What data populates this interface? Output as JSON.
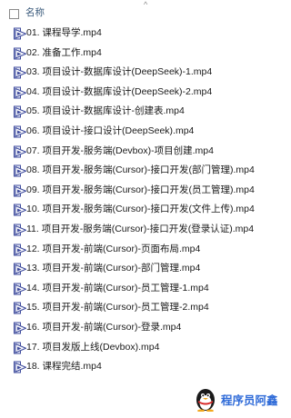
{
  "header": {
    "sort_indicator": "^",
    "column_name": "名称"
  },
  "files": [
    {
      "name": "01. 课程导学.mp4"
    },
    {
      "name": "02. 准备工作.mp4"
    },
    {
      "name": "03. 项目设计-数据库设计(DeepSeek)-1.mp4"
    },
    {
      "name": "04. 项目设计-数据库设计(DeepSeek)-2.mp4"
    },
    {
      "name": "05. 项目设计-数据库设计-创建表.mp4"
    },
    {
      "name": "06. 项目设计-接口设计(DeepSeek).mp4"
    },
    {
      "name": "07. 项目开发-服务端(Devbox)-项目创建.mp4"
    },
    {
      "name": "08. 项目开发-服务端(Cursor)-接口开发(部门管理).mp4"
    },
    {
      "name": "09. 项目开发-服务端(Cursor)-接口开发(员工管理).mp4"
    },
    {
      "name": "10. 项目开发-服务端(Cursor)-接口开发(文件上传).mp4"
    },
    {
      "name": "11. 项目开发-服务端(Cursor)-接口开发(登录认证).mp4"
    },
    {
      "name": "12. 项目开发-前端(Cursor)-页面布局.mp4"
    },
    {
      "name": "13. 项目开发-前端(Cursor)-部门管理.mp4"
    },
    {
      "name": "14. 项目开发-前端(Cursor)-员工管理-1.mp4"
    },
    {
      "name": "15. 项目开发-前端(Cursor)-员工管理-2.mp4"
    },
    {
      "name": "16. 项目开发-前端(Cursor)-登录.mp4"
    },
    {
      "name": "17. 项目发版上线(Devbox).mp4"
    },
    {
      "name": "18. 课程完结.mp4"
    }
  ],
  "icons": {
    "video_file": "video-file-icon",
    "watermark_logo": "penguin-logo-icon"
  },
  "watermark": {
    "text": "程序员阿鑫"
  },
  "colors": {
    "icon_stroke": "#3d4a9c",
    "icon_fill": "#e9ecf7",
    "header_text": "#3b5b7c",
    "watermark_text": "#2f6bd8"
  }
}
